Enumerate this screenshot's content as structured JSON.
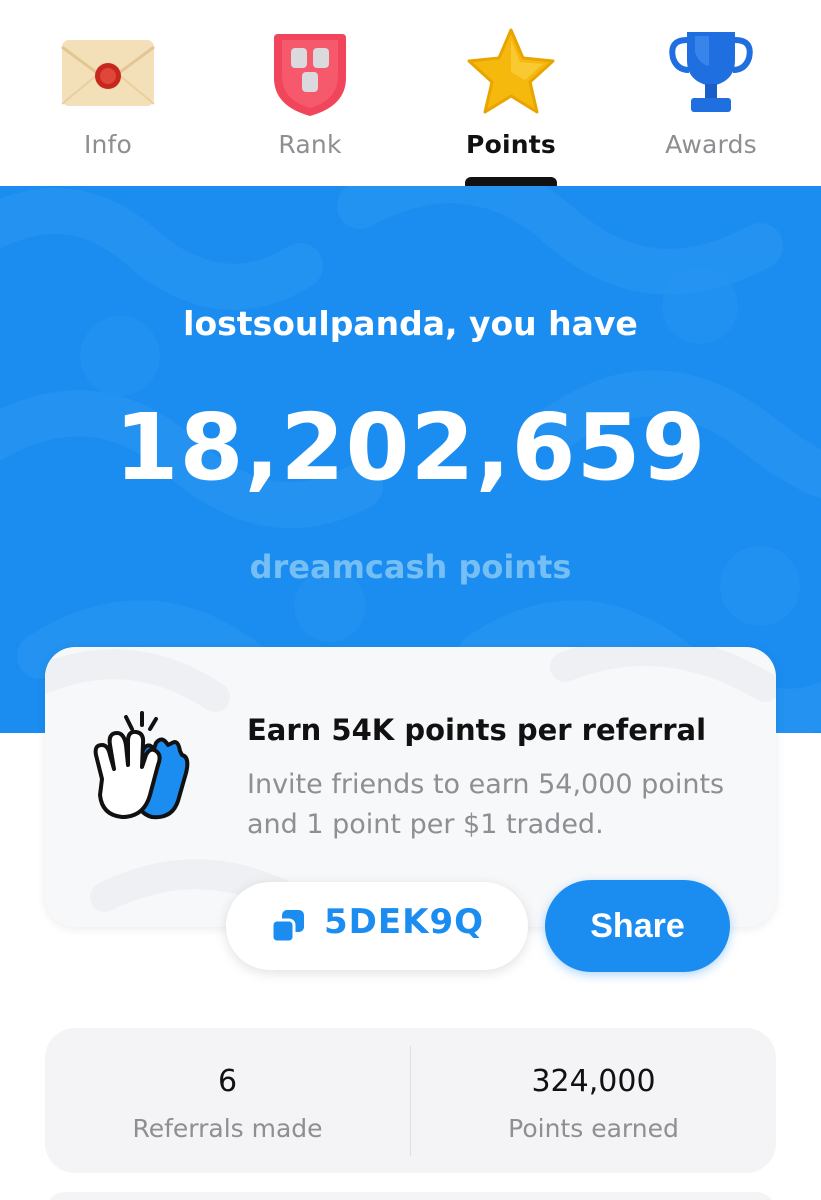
{
  "tabs": [
    {
      "label": "Info",
      "icon": "envelope-icon",
      "active": false
    },
    {
      "label": "Rank",
      "icon": "shield-icon",
      "active": false
    },
    {
      "label": "Points",
      "icon": "star-icon",
      "active": true
    },
    {
      "label": "Awards",
      "icon": "trophy-icon",
      "active": false
    }
  ],
  "hero": {
    "greeting": "lostsoulpanda, you have",
    "points": "18,202,659",
    "unit": "dreamcash points"
  },
  "referral": {
    "title": "Earn 54K points per referral",
    "description": "Invite friends to earn 54,000 points and 1 point per $1 traded.",
    "code": "5DEK9Q",
    "share_label": "Share",
    "icon": "waving-hands-icon"
  },
  "stats": [
    {
      "value": "6",
      "label": "Referrals made"
    },
    {
      "value": "324,000",
      "label": "Points earned"
    }
  ],
  "colors": {
    "accent": "#1b8df0",
    "muted_text": "#8e8e93",
    "hero_subtitle": "#76bff5"
  }
}
